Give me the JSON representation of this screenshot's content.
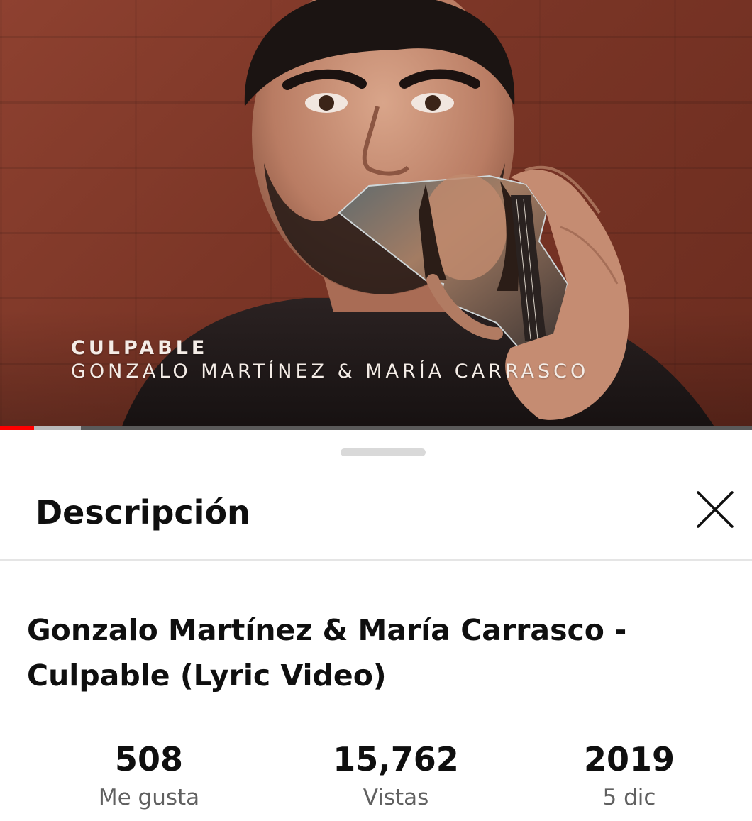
{
  "video": {
    "overlay_title": "CULPABLE",
    "overlay_artists": "GONZALO MARTÍNEZ & MARÍA CARRASCO",
    "progress": {
      "played_fraction": 0.045,
      "buffered_fraction": 0.108
    }
  },
  "sheet": {
    "title": "Descripción",
    "close_icon": "close-icon",
    "headline": "Gonzalo Martínez & María Carrasco  -\nCulpable (Lyric Video)",
    "stats": [
      {
        "value": "508",
        "label": "Me gusta"
      },
      {
        "value": "15,762",
        "label": "Vistas"
      },
      {
        "value": "2019",
        "label": "5 dic"
      }
    ]
  },
  "colors": {
    "progress_played": "#ff0000",
    "text_primary": "#0f0f0f",
    "text_secondary": "#606060"
  }
}
